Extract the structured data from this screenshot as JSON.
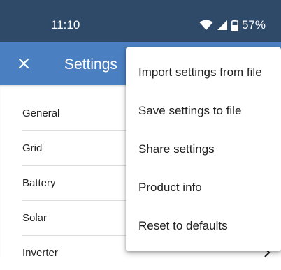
{
  "status_bar": {
    "time": "11:10",
    "battery_percent": "57%",
    "icons": [
      "wifi-icon",
      "cell-signal-icon",
      "battery-icon"
    ]
  },
  "app_bar": {
    "title": "Settings",
    "close_icon": "close-icon"
  },
  "settings_list": [
    {
      "label": "General"
    },
    {
      "label": "Grid"
    },
    {
      "label": "Battery"
    },
    {
      "label": "Solar"
    },
    {
      "label": "Inverter"
    }
  ],
  "overflow_menu": [
    {
      "label": "Import settings from file"
    },
    {
      "label": "Save settings to file"
    },
    {
      "label": "Share settings"
    },
    {
      "label": "Product info"
    },
    {
      "label": "Reset to defaults"
    }
  ],
  "colors": {
    "status_bar": "#2f4a69",
    "app_bar": "#4a7fc1",
    "background": "#ffffff"
  }
}
